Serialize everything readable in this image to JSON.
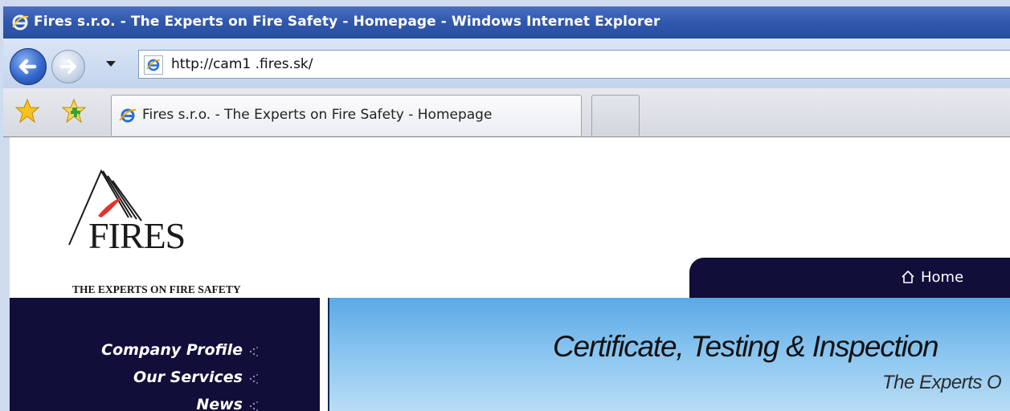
{
  "window": {
    "title": "Fires s.r.o. - The Experts on Fire Safety - Homepage - Windows Internet Explorer"
  },
  "navigation": {
    "address": "http://cam1 .fires.sk/"
  },
  "tabs": [
    {
      "label": "Fires s.r.o. - The Experts on Fire Safety - Homepage"
    }
  ],
  "page": {
    "logo": {
      "name": "FIRES",
      "tagline": "THE EXPERTS ON FIRE SAFETY"
    },
    "nav": {
      "home_label": "Home"
    },
    "sidebar": {
      "items": [
        {
          "label": "Company Profile"
        },
        {
          "label": "Our Services"
        },
        {
          "label": "News"
        }
      ]
    },
    "banner": {
      "headline": "Certificate, Testing & Inspection",
      "subline": "The Experts O"
    }
  },
  "colors": {
    "titlebar": "#2f57ad",
    "nav_dark": "#120e3a",
    "banner_sky": "#86c3ef",
    "logo_flame": "#e0342b"
  },
  "icons": [
    "ie-icon",
    "back-arrow-icon",
    "forward-arrow-icon",
    "dropdown-arrow-icon",
    "page-icon",
    "favorites-star-icon",
    "add-favorites-icon",
    "home-icon",
    "sparkle-bullet-icon"
  ]
}
